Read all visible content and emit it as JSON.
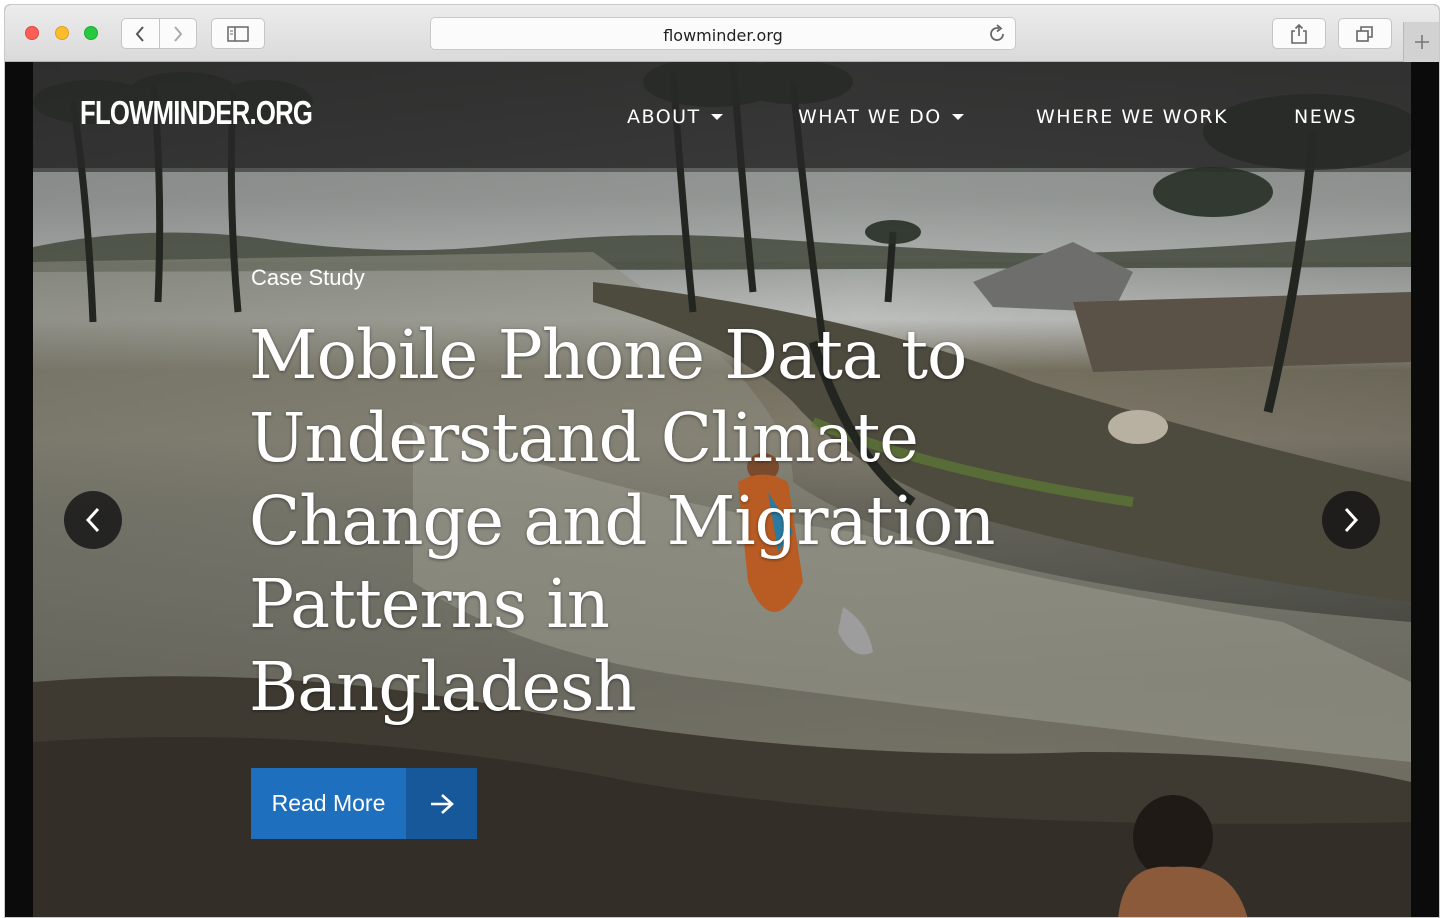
{
  "browser": {
    "url": "flowminder.org",
    "icons": {
      "back": "chevron-left-icon",
      "forward": "chevron-right-icon",
      "sidebar": "sidebar-icon",
      "reload": "reload-icon",
      "share": "share-icon",
      "tabs": "tabs-overview-icon",
      "new_tab": "plus-icon"
    }
  },
  "site": {
    "logo": "FLOWMINDER.ORG",
    "nav": [
      {
        "label": "ABOUT",
        "dropdown": true
      },
      {
        "label": "WHAT WE DO",
        "dropdown": true
      },
      {
        "label": "WHERE WE WORK",
        "dropdown": false
      },
      {
        "label": "NEWS",
        "dropdown": false
      }
    ]
  },
  "hero": {
    "kicker": "Case Study",
    "headline": "Mobile Phone Data to Understand Climate Change and Migration Patterns in Bangladesh",
    "cta_label": "Read More",
    "colors": {
      "cta": "#1f6fbf",
      "cta_arrow": "#17589b"
    }
  }
}
